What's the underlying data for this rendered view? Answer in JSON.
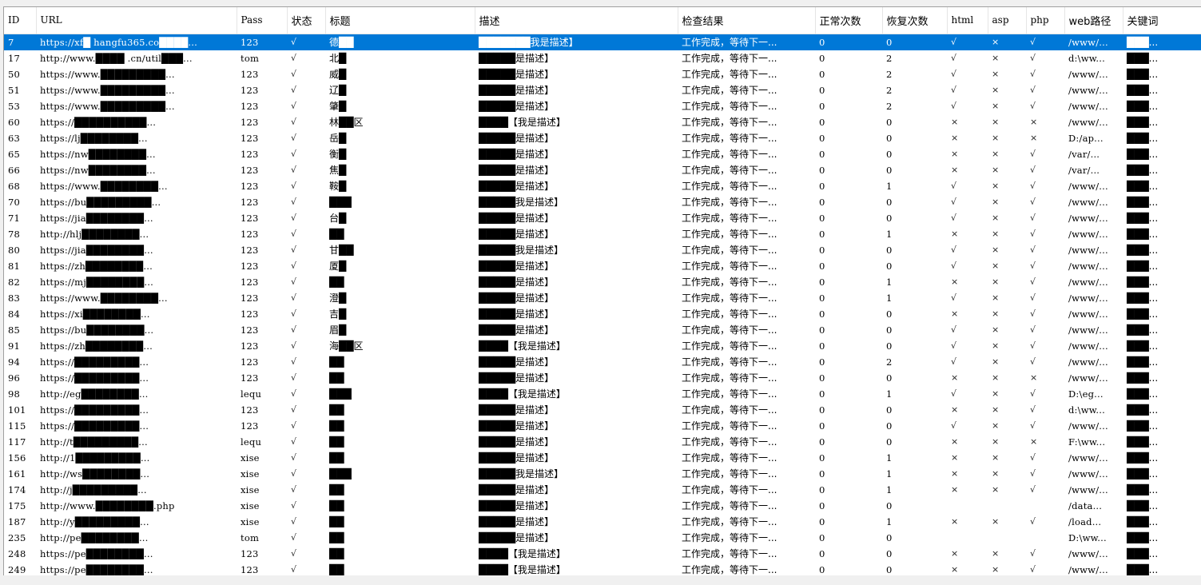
{
  "columns": [
    "ID",
    "URL",
    "Pass",
    "状态",
    "标题",
    "描述",
    "检查结果",
    "正常次数",
    "恢复次数",
    "html",
    "asp",
    "php",
    "web路径",
    "关键词"
  ],
  "rows": [
    {
      "id": "7",
      "url": "https://xf█ hangfu365.co████...",
      "pass": "123",
      "status": "√",
      "title": "德██",
      "desc": "███████我是描述】",
      "result": "工作完成，等待下一...",
      "normal": "0",
      "recover": "0",
      "html": "√",
      "asp": "×",
      "php": "√",
      "path": "/www/...",
      "kw": "███..."
    },
    {
      "id": "17",
      "url": "http://www.████ .cn/util███...",
      "pass": "tom",
      "status": "√",
      "title": "北█",
      "desc": "█████是描述】",
      "result": "工作完成，等待下一...",
      "normal": "0",
      "recover": "2",
      "html": "√",
      "asp": "×",
      "php": "√",
      "path": "d:\\ww...",
      "kw": "███..."
    },
    {
      "id": "50",
      "url": "https://www.█████████...",
      "pass": "123",
      "status": "√",
      "title": "威█",
      "desc": "█████是描述】",
      "result": "工作完成，等待下一...",
      "normal": "0",
      "recover": "2",
      "html": "√",
      "asp": "×",
      "php": "√",
      "path": "/www/...",
      "kw": "███..."
    },
    {
      "id": "51",
      "url": "https://www.█████████...",
      "pass": "123",
      "status": "√",
      "title": "辽█",
      "desc": "█████是描述】",
      "result": "工作完成，等待下一...",
      "normal": "0",
      "recover": "2",
      "html": "√",
      "asp": "×",
      "php": "√",
      "path": "/www/...",
      "kw": "███..."
    },
    {
      "id": "53",
      "url": "https://www.█████████...",
      "pass": "123",
      "status": "√",
      "title": "肇█",
      "desc": "█████是描述】",
      "result": "工作完成，等待下一...",
      "normal": "0",
      "recover": "2",
      "html": "√",
      "asp": "×",
      "php": "√",
      "path": "/www/...",
      "kw": "███..."
    },
    {
      "id": "60",
      "url": "https://██████████...",
      "pass": "123",
      "status": "√",
      "title": "林██区",
      "desc": "████【我是描述】",
      "result": "工作完成，等待下一...",
      "normal": "0",
      "recover": "0",
      "html": "×",
      "asp": "×",
      "php": "×",
      "path": "/www/...",
      "kw": "███..."
    },
    {
      "id": "63",
      "url": "https://lj████████...",
      "pass": "123",
      "status": "√",
      "title": "岳█",
      "desc": "█████是描述】",
      "result": "工作完成，等待下一...",
      "normal": "0",
      "recover": "0",
      "html": "×",
      "asp": "×",
      "php": "×",
      "path": "D:/ap...",
      "kw": "███..."
    },
    {
      "id": "65",
      "url": "https://nw████████...",
      "pass": "123",
      "status": "√",
      "title": "衡█",
      "desc": "█████是描述】",
      "result": "工作完成，等待下一...",
      "normal": "0",
      "recover": "0",
      "html": "×",
      "asp": "×",
      "php": "√",
      "path": "/var/...",
      "kw": "███..."
    },
    {
      "id": "66",
      "url": "https://nw████████...",
      "pass": "123",
      "status": "√",
      "title": "焦█",
      "desc": "█████是描述】",
      "result": "工作完成，等待下一...",
      "normal": "0",
      "recover": "0",
      "html": "×",
      "asp": "×",
      "php": "√",
      "path": "/var/...",
      "kw": "███..."
    },
    {
      "id": "68",
      "url": "https://www.████████...",
      "pass": "123",
      "status": "√",
      "title": "鞍█",
      "desc": "█████是描述】",
      "result": "工作完成，等待下一...",
      "normal": "0",
      "recover": "1",
      "html": "√",
      "asp": "×",
      "php": "√",
      "path": "/www/...",
      "kw": "███..."
    },
    {
      "id": "70",
      "url": "https://bu█████████...",
      "pass": "123",
      "status": "√",
      "title": "███",
      "desc": "█████我是描述】",
      "result": "工作完成，等待下一...",
      "normal": "0",
      "recover": "0",
      "html": "√",
      "asp": "×",
      "php": "√",
      "path": "/www/...",
      "kw": "███..."
    },
    {
      "id": "71",
      "url": "https://jia████████...",
      "pass": "123",
      "status": "√",
      "title": "台█",
      "desc": "█████是描述】",
      "result": "工作完成，等待下一...",
      "normal": "0",
      "recover": "0",
      "html": "√",
      "asp": "×",
      "php": "√",
      "path": "/www/...",
      "kw": "███..."
    },
    {
      "id": "78",
      "url": "http://hlj████████...",
      "pass": "123",
      "status": "√",
      "title": "██",
      "desc": "█████是描述】",
      "result": "工作完成，等待下一...",
      "normal": "0",
      "recover": "1",
      "html": "×",
      "asp": "×",
      "php": "√",
      "path": "/www/...",
      "kw": "███..."
    },
    {
      "id": "80",
      "url": "https://jia████████...",
      "pass": "123",
      "status": "√",
      "title": "甘██",
      "desc": "█████我是描述】",
      "result": "工作完成，等待下一...",
      "normal": "0",
      "recover": "0",
      "html": "√",
      "asp": "×",
      "php": "√",
      "path": "/www/...",
      "kw": "███..."
    },
    {
      "id": "81",
      "url": "https://zh████████...",
      "pass": "123",
      "status": "√",
      "title": "厦█",
      "desc": "█████是描述】",
      "result": "工作完成，等待下一...",
      "normal": "0",
      "recover": "0",
      "html": "√",
      "asp": "×",
      "php": "√",
      "path": "/www/...",
      "kw": "███..."
    },
    {
      "id": "82",
      "url": "https://mj████████...",
      "pass": "123",
      "status": "√",
      "title": "██",
      "desc": "█████是描述】",
      "result": "工作完成，等待下一...",
      "normal": "0",
      "recover": "1",
      "html": "×",
      "asp": "×",
      "php": "√",
      "path": "/www/...",
      "kw": "███..."
    },
    {
      "id": "83",
      "url": "https://www.████████...",
      "pass": "123",
      "status": "√",
      "title": "澄█",
      "desc": "█████是描述】",
      "result": "工作完成，等待下一...",
      "normal": "0",
      "recover": "1",
      "html": "√",
      "asp": "×",
      "php": "√",
      "path": "/www/...",
      "kw": "███..."
    },
    {
      "id": "84",
      "url": "https://xi████████...",
      "pass": "123",
      "status": "√",
      "title": "吉█",
      "desc": "█████是描述】",
      "result": "工作完成，等待下一...",
      "normal": "0",
      "recover": "0",
      "html": "×",
      "asp": "×",
      "php": "√",
      "path": "/www/...",
      "kw": "███..."
    },
    {
      "id": "85",
      "url": "https://bu████████...",
      "pass": "123",
      "status": "√",
      "title": "眉█",
      "desc": "█████是描述】",
      "result": "工作完成，等待下一...",
      "normal": "0",
      "recover": "0",
      "html": "√",
      "asp": "×",
      "php": "√",
      "path": "/www/...",
      "kw": "███..."
    },
    {
      "id": "91",
      "url": "https://zh████████...",
      "pass": "123",
      "status": "√",
      "title": "海██区",
      "desc": "████【我是描述】",
      "result": "工作完成，等待下一...",
      "normal": "0",
      "recover": "0",
      "html": "√",
      "asp": "×",
      "php": "√",
      "path": "/www/...",
      "kw": "███..."
    },
    {
      "id": "94",
      "url": "https://█████████...",
      "pass": "123",
      "status": "√",
      "title": "██",
      "desc": "█████是描述】",
      "result": "工作完成，等待下一...",
      "normal": "0",
      "recover": "2",
      "html": "√",
      "asp": "×",
      "php": "√",
      "path": "/www/...",
      "kw": "███..."
    },
    {
      "id": "96",
      "url": "https://█████████...",
      "pass": "123",
      "status": "√",
      "title": "██",
      "desc": "█████是描述】",
      "result": "工作完成，等待下一...",
      "normal": "0",
      "recover": "0",
      "html": "×",
      "asp": "×",
      "php": "×",
      "path": "/www/...",
      "kw": "███..."
    },
    {
      "id": "98",
      "url": "http://eg████████...",
      "pass": "lequ",
      "status": "√",
      "title": "███",
      "desc": "████【我是描述】",
      "result": "工作完成，等待下一...",
      "normal": "0",
      "recover": "1",
      "html": "√",
      "asp": "×",
      "php": "√",
      "path": "D:\\eg...",
      "kw": "███..."
    },
    {
      "id": "101",
      "url": "https://█████████...",
      "pass": "123",
      "status": "√",
      "title": "██",
      "desc": "█████是描述】",
      "result": "工作完成，等待下一...",
      "normal": "0",
      "recover": "0",
      "html": "×",
      "asp": "×",
      "php": "√",
      "path": "d:\\ww...",
      "kw": "███..."
    },
    {
      "id": "115",
      "url": "https://█████████...",
      "pass": "123",
      "status": "√",
      "title": "██",
      "desc": "█████是描述】",
      "result": "工作完成，等待下一...",
      "normal": "0",
      "recover": "0",
      "html": "√",
      "asp": "×",
      "php": "√",
      "path": "/www/...",
      "kw": "███..."
    },
    {
      "id": "117",
      "url": "http://t█████████...",
      "pass": "lequ",
      "status": "√",
      "title": "██",
      "desc": "█████是描述】",
      "result": "工作完成，等待下一...",
      "normal": "0",
      "recover": "0",
      "html": "×",
      "asp": "×",
      "php": "×",
      "path": "F:\\ww...",
      "kw": "███..."
    },
    {
      "id": "156",
      "url": "http://1█████████...",
      "pass": "xise",
      "status": "√",
      "title": "██",
      "desc": "█████是描述】",
      "result": "工作完成，等待下一...",
      "normal": "0",
      "recover": "1",
      "html": "×",
      "asp": "×",
      "php": "√",
      "path": "/www/...",
      "kw": "███..."
    },
    {
      "id": "161",
      "url": "http://ws████████...",
      "pass": "xise",
      "status": "√",
      "title": "███",
      "desc": "█████我是描述】",
      "result": "工作完成，等待下一...",
      "normal": "0",
      "recover": "1",
      "html": "×",
      "asp": "×",
      "php": "√",
      "path": "/www/...",
      "kw": "███..."
    },
    {
      "id": "174",
      "url": "http://j█████████...",
      "pass": "xise",
      "status": "√",
      "title": "██",
      "desc": "█████是描述】",
      "result": "工作完成，等待下一...",
      "normal": "0",
      "recover": "1",
      "html": "×",
      "asp": "×",
      "php": "√",
      "path": "/www/...",
      "kw": "███..."
    },
    {
      "id": "175",
      "url": "http://www.████████.php",
      "pass": "xise",
      "status": "√",
      "title": "██",
      "desc": "█████是描述】",
      "result": "工作完成，等待下一...",
      "normal": "0",
      "recover": "0",
      "html": "",
      "asp": "",
      "php": "",
      "path": "/data...",
      "kw": "███..."
    },
    {
      "id": "187",
      "url": "http://y█████████...",
      "pass": "xise",
      "status": "√",
      "title": "██",
      "desc": "█████是描述】",
      "result": "工作完成，等待下一...",
      "normal": "0",
      "recover": "1",
      "html": "×",
      "asp": "×",
      "php": "√",
      "path": "/load...",
      "kw": "███..."
    },
    {
      "id": "235",
      "url": "http://pe████████...",
      "pass": "tom",
      "status": "√",
      "title": "██",
      "desc": "█████是描述】",
      "result": "工作完成，等待下一...",
      "normal": "0",
      "recover": "0",
      "html": "",
      "asp": "",
      "php": "",
      "path": "D:\\ww...",
      "kw": "███..."
    },
    {
      "id": "248",
      "url": "https://pe████████...",
      "pass": "123",
      "status": "√",
      "title": "██",
      "desc": "████【我是描述】",
      "result": "工作完成，等待下一...",
      "normal": "0",
      "recover": "0",
      "html": "×",
      "asp": "×",
      "php": "√",
      "path": "/www/...",
      "kw": "███..."
    },
    {
      "id": "249",
      "url": "https://pe████████...",
      "pass": "123",
      "status": "√",
      "title": "██",
      "desc": "████【我是描述】",
      "result": "工作完成，等待下一...",
      "normal": "0",
      "recover": "0",
      "html": "×",
      "asp": "×",
      "php": "√",
      "path": "/www/...",
      "kw": "███..."
    }
  ],
  "selected_row": 0,
  "colors": {
    "selection": "#0078d7",
    "grid_line": "#e5e5e5",
    "background": "#ffffff",
    "chrome": "#f0f0f0"
  }
}
